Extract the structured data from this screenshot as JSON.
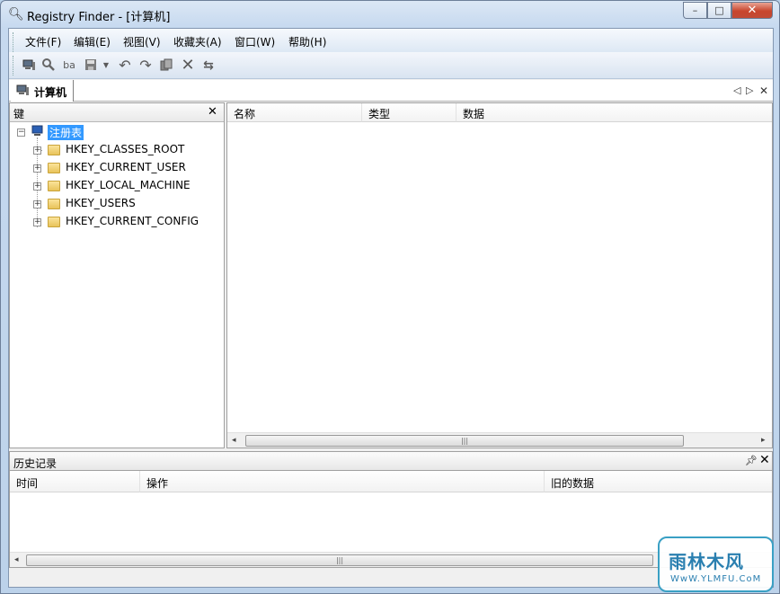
{
  "window": {
    "title": "Registry Finder - [计算机]",
    "icon": "search-icon",
    "controls": {
      "minimize": "–",
      "maximize": "□",
      "close": "✕"
    }
  },
  "menu": [
    "文件(F)",
    "编辑(E)",
    "视图(V)",
    "收藏夹(A)",
    "窗口(W)",
    "帮助(H)"
  ],
  "toolbar": {
    "icons": [
      "computer-icon",
      "search-icon",
      "replace-icon",
      "save-icon",
      "dropdown-icon",
      "undo-icon",
      "redo-icon",
      "copy-icon",
      "delete-icon",
      "refresh-icon"
    ]
  },
  "doc_tab": {
    "label": "计算机",
    "icon": "computer-icon"
  },
  "left_pane": {
    "header": "键",
    "root_label": "注册表",
    "keys": [
      "HKEY_CLASSES_ROOT",
      "HKEY_CURRENT_USER",
      "HKEY_LOCAL_MACHINE",
      "HKEY_USERS",
      "HKEY_CURRENT_CONFIG"
    ]
  },
  "right_pane": {
    "columns": [
      "名称",
      "类型",
      "数据"
    ]
  },
  "history": {
    "title": "历史记录",
    "columns": [
      "时间",
      "操作",
      "旧的数据"
    ]
  },
  "watermark": {
    "main": "雨林木风",
    "sub": "WwW.YLMFU.CoM"
  }
}
